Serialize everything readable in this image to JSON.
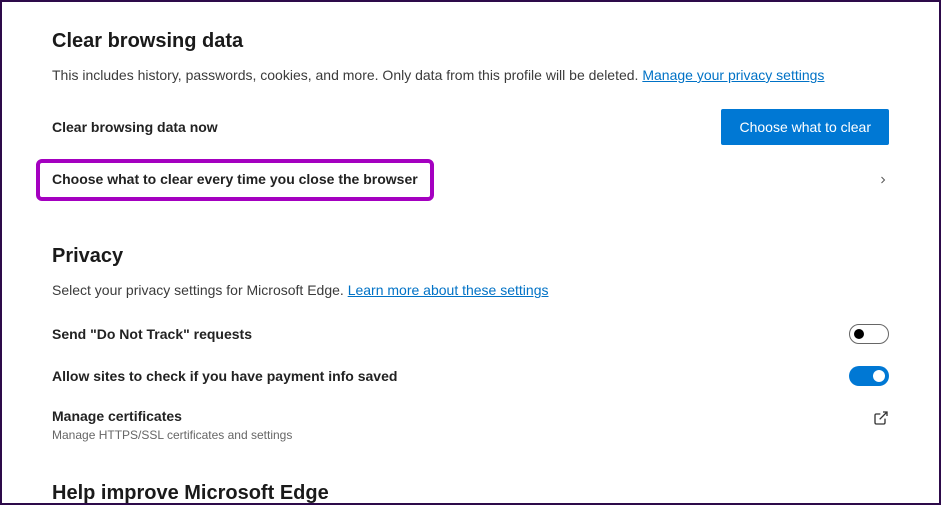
{
  "clearData": {
    "title": "Clear browsing data",
    "desc": "This includes history, passwords, cookies, and more. Only data from this profile will be deleted. ",
    "link": "Manage your privacy settings",
    "nowLabel": "Clear browsing data now",
    "buttonLabel": "Choose what to clear",
    "onCloseLabel": "Choose what to clear every time you close the browser"
  },
  "privacy": {
    "title": "Privacy",
    "desc": "Select your privacy settings for Microsoft Edge. ",
    "link": "Learn more about these settings",
    "dntLabel": "Send \"Do Not Track\" requests",
    "paymentLabel": "Allow sites to check if you have payment info saved",
    "certLabel": "Manage certificates",
    "certSub": "Manage HTTPS/SSL certificates and settings"
  },
  "helpImprove": {
    "title": "Help improve Microsoft Edge"
  }
}
